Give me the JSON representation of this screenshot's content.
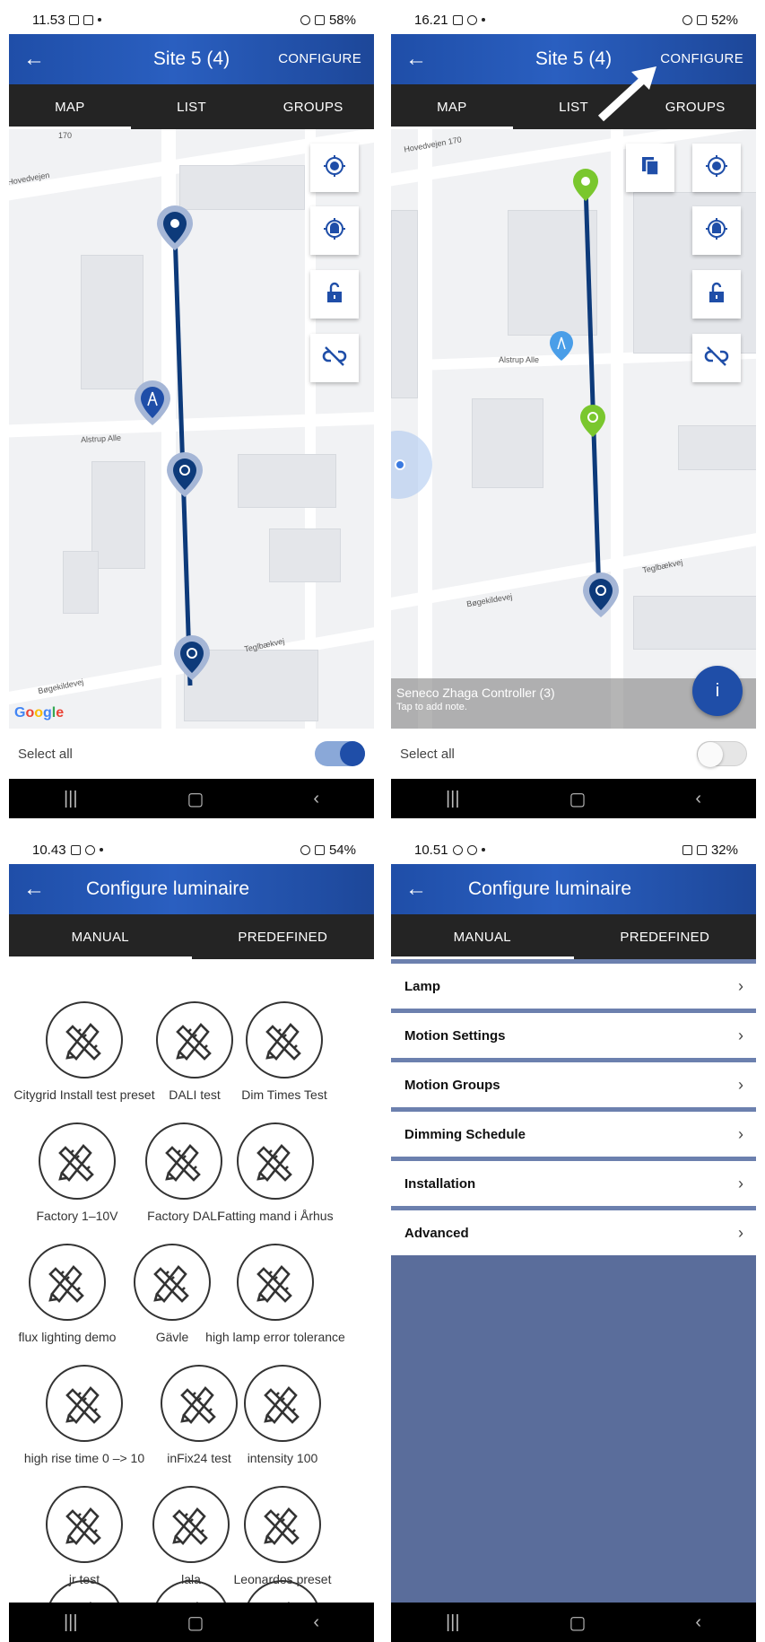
{
  "screens": [
    {
      "status": {
        "time": "11.53",
        "battery": "58%"
      },
      "appbar": {
        "back_icon": "arrow-left-icon",
        "title": "Site 5 (4)",
        "action": "CONFIGURE"
      },
      "tabs": [
        "MAP",
        "LIST",
        "GROUPS"
      ],
      "active_tab": "MAP",
      "map": {
        "streets": [
          "170",
          "Hovedvejen",
          "Alstrup Alle",
          "Teglbækvej",
          "Bøgekildevej"
        ],
        "google": "Google",
        "buttons": [
          "locate-icon",
          "target-icon",
          "unlock-icon",
          "unlink-icon"
        ],
        "pins": {
          "route_color": "#0d3a7a",
          "antenna_color": "#1f4ea8"
        }
      },
      "select_all": {
        "label": "Select all",
        "state": "on"
      }
    },
    {
      "status": {
        "time": "16.21",
        "battery": "52%"
      },
      "appbar": {
        "back_icon": "arrow-left-icon",
        "title": "Site 5 (4)",
        "action": "CONFIGURE"
      },
      "tabs": [
        "MAP",
        "LIST",
        "GROUPS"
      ],
      "active_tab": "MAP",
      "map": {
        "streets": [
          "Hovedvejen 170",
          "Alstrup Alle",
          "Teglbækvej",
          "Bøgekildevej"
        ],
        "buttons": [
          "copy-icon",
          "locate-icon",
          "target-icon",
          "unlock-icon",
          "unlink-icon"
        ],
        "selected_color": "#7ac72e",
        "info": {
          "title": "Seneco Zhaga Controller (3)",
          "subtitle": "Tap to add note."
        },
        "fab": "i"
      },
      "select_all": {
        "label": "Select all",
        "state": "off"
      }
    },
    {
      "status": {
        "time": "10.43",
        "battery": "54%"
      },
      "appbar": {
        "back_icon": "arrow-left-icon",
        "title": "Configure luminaire"
      },
      "tabs": [
        "MANUAL",
        "PREDEFINED"
      ],
      "active_tab": "MANUAL",
      "presets": [
        "Citygrid Install test preset",
        "DALI test",
        "Dim Times Test",
        "Factory 1–10V",
        "Factory DALI",
        "Fatting mand i Århus",
        "flux lighting demo",
        "Gävle",
        "high lamp error tolerance",
        "high rise time 0 –> 10",
        "inFix24 test",
        "intensity 100",
        "jr test",
        "lala",
        "Leonardos preset"
      ]
    },
    {
      "status": {
        "time": "10.51",
        "battery": "32%"
      },
      "appbar": {
        "back_icon": "arrow-left-icon",
        "title": "Configure luminaire"
      },
      "tabs": [
        "MANUAL",
        "PREDEFINED"
      ],
      "active_tab": "MANUAL",
      "menu": [
        "Lamp",
        "Motion Settings",
        "Motion Groups",
        "Dimming Schedule",
        "Installation",
        "Advanced"
      ]
    }
  ],
  "nav_icons": [
    "recent-apps-icon",
    "home-icon",
    "back-icon"
  ]
}
